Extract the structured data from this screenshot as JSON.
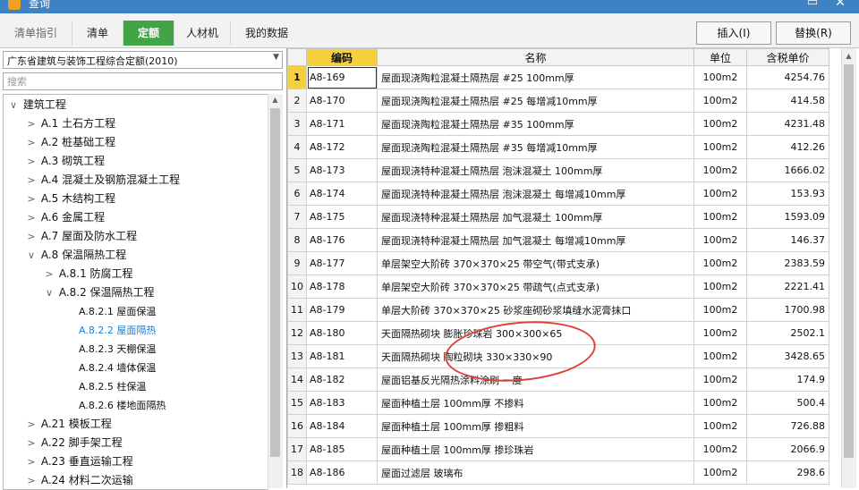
{
  "window": {
    "title": "查询"
  },
  "tabs": [
    {
      "label": "清单指引"
    },
    {
      "label": "清单"
    },
    {
      "label": "定额"
    },
    {
      "label": "人材机"
    },
    {
      "label": "我的数据"
    }
  ],
  "actions": {
    "insert_label": "插入(I)",
    "replace_label": "替换(R)"
  },
  "left": {
    "quota_library": "广东省建筑与装饰工程综合定额(2010)",
    "search_placeholder": "搜索",
    "tree": [
      {
        "label": "建筑工程",
        "toggle": "∨"
      },
      {
        "label": "A.1 土石方工程",
        "toggle": ">"
      },
      {
        "label": "A.2 桩基础工程",
        "toggle": ">"
      },
      {
        "label": "A.3 砌筑工程",
        "toggle": ">"
      },
      {
        "label": "A.4 混凝土及钢筋混凝土工程",
        "toggle": ">"
      },
      {
        "label": "A.5 木结构工程",
        "toggle": ">"
      },
      {
        "label": "A.6 金属工程",
        "toggle": ">"
      },
      {
        "label": "A.7 屋面及防水工程",
        "toggle": ">"
      },
      {
        "label": "A.8 保温隔热工程",
        "toggle": "∨"
      },
      {
        "label": "A.8.1 防腐工程",
        "toggle": ">"
      },
      {
        "label": "A.8.2 保温隔热工程",
        "toggle": "∨"
      },
      {
        "label": "A.8.2.1 屋面保温",
        "toggle": ""
      },
      {
        "label": "A.8.2.2 屋面隔热",
        "toggle": ""
      },
      {
        "label": "A.8.2.3 天棚保温",
        "toggle": ""
      },
      {
        "label": "A.8.2.4 墙体保温",
        "toggle": ""
      },
      {
        "label": "A.8.2.5 柱保温",
        "toggle": ""
      },
      {
        "label": "A.8.2.6 楼地面隔热",
        "toggle": ""
      },
      {
        "label": "A.21 模板工程",
        "toggle": ">"
      },
      {
        "label": "A.22 脚手架工程",
        "toggle": ">"
      },
      {
        "label": "A.23 垂直运输工程",
        "toggle": ">"
      },
      {
        "label": "A.24 材料二次运输",
        "toggle": ">"
      }
    ]
  },
  "table": {
    "columns": [
      "编码",
      "名称",
      "单位",
      "含税单价"
    ],
    "rows": [
      {
        "no": "1",
        "code": "A8-169",
        "name": "屋面现浇陶粒混凝土隔热层 #25 100mm厚",
        "unit": "100m2",
        "price": "4254.76"
      },
      {
        "no": "2",
        "code": "A8-170",
        "name": "屋面现浇陶粒混凝土隔热层 #25 每增减10mm厚",
        "unit": "100m2",
        "price": "414.58"
      },
      {
        "no": "3",
        "code": "A8-171",
        "name": "屋面现浇陶粒混凝土隔热层 #35 100mm厚",
        "unit": "100m2",
        "price": "4231.48"
      },
      {
        "no": "4",
        "code": "A8-172",
        "name": "屋面现浇陶粒混凝土隔热层 #35 每增减10mm厚",
        "unit": "100m2",
        "price": "412.26"
      },
      {
        "no": "5",
        "code": "A8-173",
        "name": "屋面现浇特种混凝土隔热层 泡沫混凝土 100mm厚",
        "unit": "100m2",
        "price": "1666.02"
      },
      {
        "no": "6",
        "code": "A8-174",
        "name": "屋面现浇特种混凝土隔热层 泡沫混凝土 每增减10mm厚",
        "unit": "100m2",
        "price": "153.93"
      },
      {
        "no": "7",
        "code": "A8-175",
        "name": "屋面现浇特种混凝土隔热层 加气混凝土 100mm厚",
        "unit": "100m2",
        "price": "1593.09"
      },
      {
        "no": "8",
        "code": "A8-176",
        "name": "屋面现浇特种混凝土隔热层 加气混凝土 每增减10mm厚",
        "unit": "100m2",
        "price": "146.37"
      },
      {
        "no": "9",
        "code": "A8-177",
        "name": "单层架空大阶砖 370×370×25 带空气(带式支承)",
        "unit": "100m2",
        "price": "2383.59"
      },
      {
        "no": "10",
        "code": "A8-178",
        "name": "单层架空大阶砖 370×370×25 带疏气(点式支承)",
        "unit": "100m2",
        "price": "2221.41"
      },
      {
        "no": "11",
        "code": "A8-179",
        "name": "单层大阶砖 370×370×25 砂浆座砌砂浆填缝水泥膏抹口",
        "unit": "100m2",
        "price": "1700.98"
      },
      {
        "no": "12",
        "code": "A8-180",
        "name": "天面隔热砌块 膨胀珍珠岩 300×300×65",
        "unit": "100m2",
        "price": "2502.1"
      },
      {
        "no": "13",
        "code": "A8-181",
        "name": "天面隔热砌块 陶粒砌块 330×330×90",
        "unit": "100m2",
        "price": "3428.65"
      },
      {
        "no": "14",
        "code": "A8-182",
        "name": "屋面铝基反光隔热涂料涂刷 一度",
        "unit": "100m2",
        "price": "174.9"
      },
      {
        "no": "15",
        "code": "A8-183",
        "name": "屋面种植土层 100mm厚 不掺料",
        "unit": "100m2",
        "price": "500.4"
      },
      {
        "no": "16",
        "code": "A8-184",
        "name": "屋面种植土层 100mm厚 掺粗料",
        "unit": "100m2",
        "price": "726.88"
      },
      {
        "no": "17",
        "code": "A8-185",
        "name": "屋面种植土层 100mm厚 掺珍珠岩",
        "unit": "100m2",
        "price": "2066.9"
      },
      {
        "no": "18",
        "code": "A8-186",
        "name": "屋面过滤层 玻璃布",
        "unit": "100m2",
        "price": "298.6"
      }
    ]
  },
  "colors": {
    "active_tab": "#43a447",
    "header_highlight": "#f4d03f",
    "annotation": "#e0403a"
  }
}
